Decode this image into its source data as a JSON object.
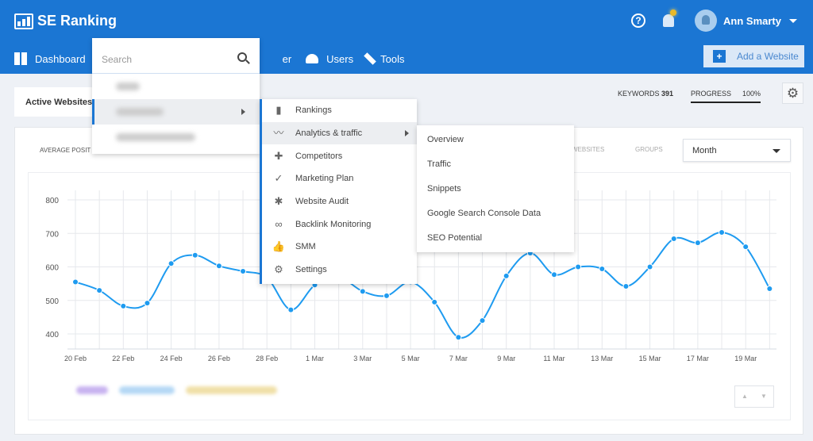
{
  "header": {
    "brand": "SE Ranking",
    "user": "Ann Smarty",
    "add_website": "Add a Website"
  },
  "nav": [
    {
      "label": "Dashboard",
      "icon": "dashboard-icon"
    },
    {
      "label": "er",
      "icon": ""
    },
    {
      "label": "Users",
      "icon": "users-icon"
    },
    {
      "label": "Tools",
      "icon": "wrench-icon"
    }
  ],
  "subheader": {
    "tab": "Active Websites",
    "keywords_label": "KEYWORDS",
    "keywords_count": "391",
    "progress_label": "PROGRESS",
    "progress_value": "100%"
  },
  "card": {
    "title": "AVERAGE POSIT",
    "toggle_websites": "WEBSITES",
    "toggle_groups": "GROUPS",
    "period": "Month"
  },
  "search_menu": {
    "placeholder": "Search"
  },
  "project_menu": [
    {
      "label": "Rankings",
      "icon": "bar-chart-icon"
    },
    {
      "label": "Analytics & traffic",
      "icon": "trend-icon",
      "active": true
    },
    {
      "label": "Competitors",
      "icon": "competitors-icon"
    },
    {
      "label": "Marketing Plan",
      "icon": "checkmarks-icon"
    },
    {
      "label": "Website Audit",
      "icon": "bug-icon"
    },
    {
      "label": "Backlink Monitoring",
      "icon": "link-icon"
    },
    {
      "label": "SMM",
      "icon": "thumbs-icon"
    },
    {
      "label": "Settings",
      "icon": "gear-icon"
    }
  ],
  "analytics_submenu": [
    "Overview",
    "Traffic",
    "Snippets",
    "Google Search Console Data",
    "SEO Potential"
  ],
  "colors": {
    "brand": "#1b76d3",
    "line": "#1e9bf0"
  },
  "chart_data": {
    "type": "line",
    "x": [
      "20 Feb",
      "21 Feb",
      "22 Feb",
      "23 Feb",
      "24 Feb",
      "25 Feb",
      "26 Feb",
      "27 Feb",
      "28 Feb",
      "29 Feb",
      "1 Mar",
      "2 Mar",
      "3 Mar",
      "4 Mar",
      "5 Mar",
      "6 Mar",
      "7 Mar",
      "8 Mar",
      "9 Mar",
      "10 Mar",
      "11 Mar",
      "12 Mar",
      "13 Mar",
      "14 Mar",
      "15 Mar",
      "16 Mar",
      "17 Mar",
      "18 Mar",
      "19 Mar",
      "20 Mar"
    ],
    "x_tick_labels": [
      "20 Feb",
      "22 Feb",
      "24 Feb",
      "26 Feb",
      "28 Feb",
      "1 Mar",
      "3 Mar",
      "5 Mar",
      "7 Mar",
      "9 Mar",
      "11 Mar",
      "13 Mar",
      "15 Mar",
      "17 Mar",
      "19 Mar"
    ],
    "values": [
      555,
      530,
      483,
      492,
      610,
      635,
      603,
      587,
      568,
      472,
      546,
      570,
      527,
      514,
      555,
      495,
      390,
      440,
      573,
      641,
      577,
      600,
      594,
      542,
      600,
      684,
      672,
      703,
      660,
      535
    ],
    "yticks": [
      400,
      500,
      600,
      700,
      800
    ],
    "ylim": [
      370,
      800
    ],
    "grid": true
  }
}
